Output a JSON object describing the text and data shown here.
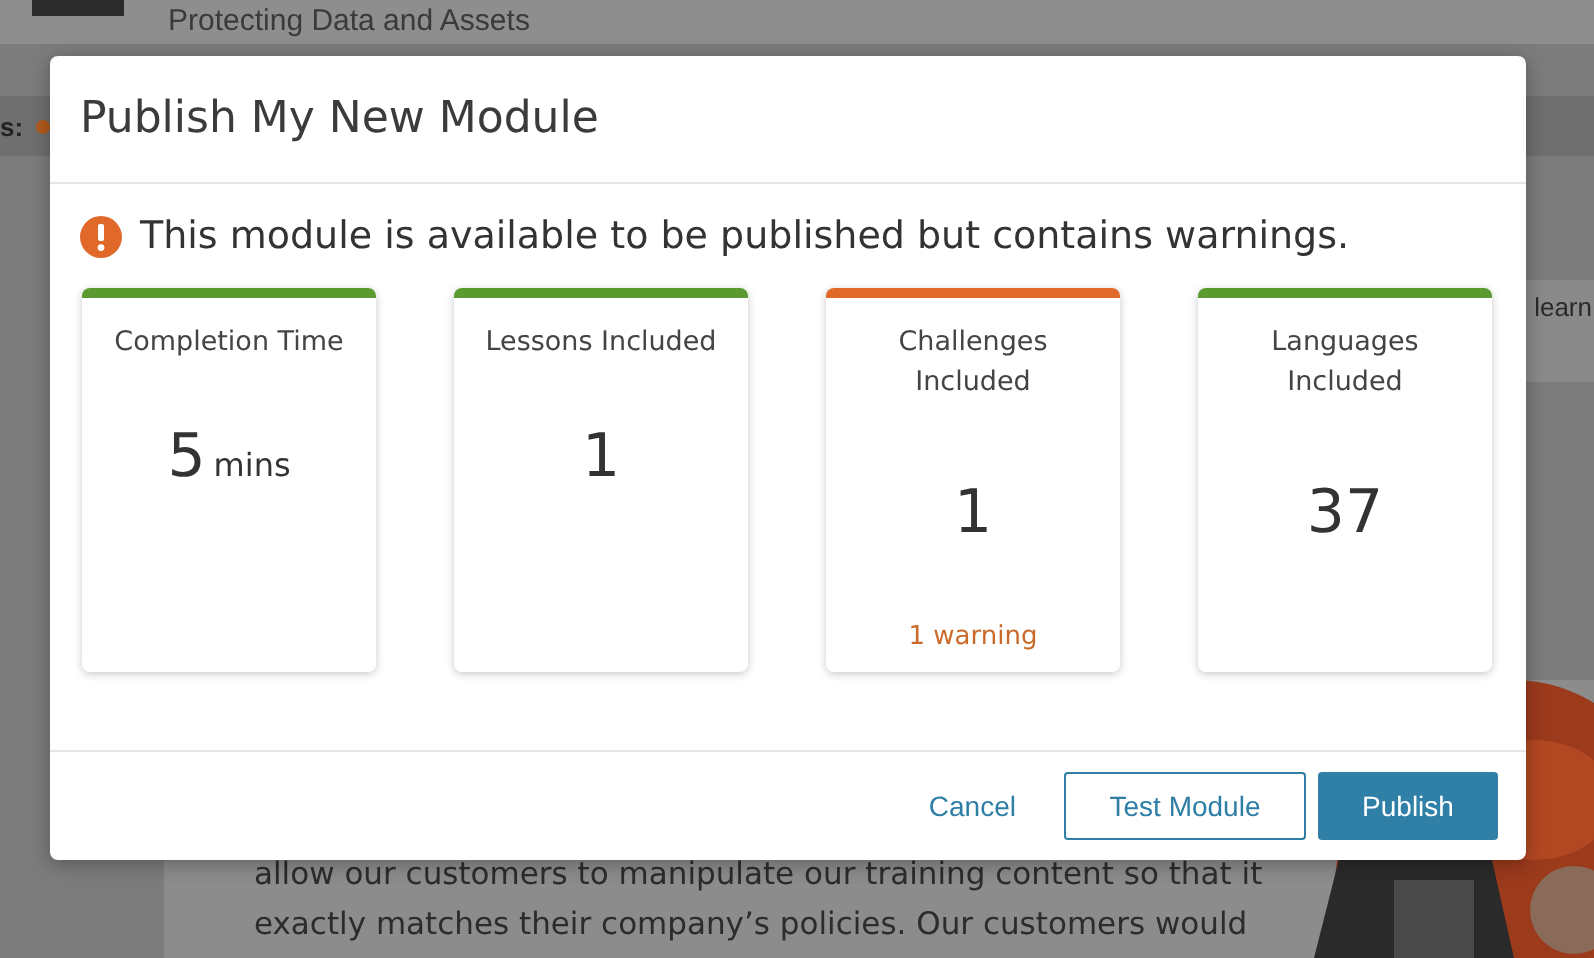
{
  "page": {
    "subtitle": "Protecting Data and Assets",
    "filter_label": "s:",
    "side_text": "learn",
    "body_lines": [
      "allow our customers to manipulate our training content so that it",
      "exactly matches their company’s policies. Our customers would"
    ]
  },
  "dialog": {
    "title": "Publish My New Module",
    "notice": "This module is available to be published but contains warnings.",
    "cards": [
      {
        "title": "Completion Time",
        "value": "5",
        "unit": "mins",
        "color": "#5a9a2e"
      },
      {
        "title": "Lessons Included",
        "value": "1",
        "color": "#5a9a2e"
      },
      {
        "title": "Challenges Included",
        "value": "1",
        "warning": "1 warning",
        "color": "#e0692a"
      },
      {
        "title": "Languages Included",
        "value": "37",
        "color": "#5a9a2e"
      }
    ],
    "buttons": [
      {
        "label": "Cancel",
        "kind": "link"
      },
      {
        "label": "Test Module",
        "kind": "outline"
      },
      {
        "label": "Publish",
        "kind": "primary"
      }
    ]
  }
}
